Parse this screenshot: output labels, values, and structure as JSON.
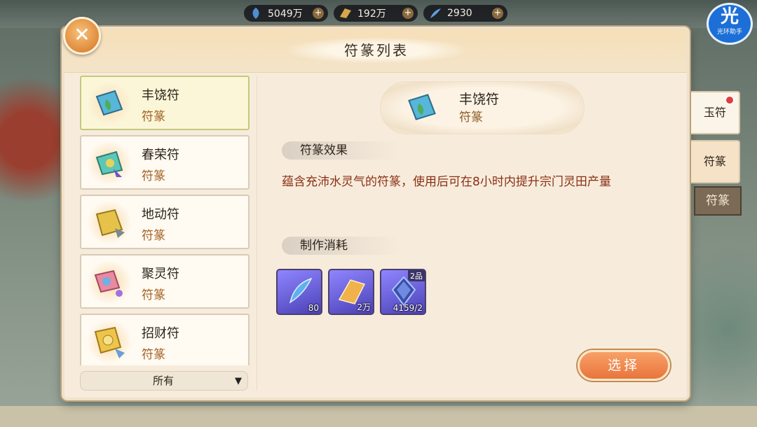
{
  "resources": [
    {
      "icon": "blue-leaf-icon",
      "value": "5049万"
    },
    {
      "icon": "talisman-paper-icon",
      "value": "192万"
    },
    {
      "icon": "blue-feather-icon",
      "value": "2930"
    }
  ],
  "badge": {
    "main": "光",
    "sub": "光环助手"
  },
  "title": "符篆列表",
  "list": {
    "items": [
      {
        "name": "丰饶符",
        "type": "符篆",
        "icon": "fengrao-talisman-icon"
      },
      {
        "name": "春荣符",
        "type": "符篆",
        "icon": "chunrong-talisman-icon"
      },
      {
        "name": "地动符",
        "type": "符篆",
        "icon": "didong-talisman-icon"
      },
      {
        "name": "聚灵符",
        "type": "符篆",
        "icon": "juling-talisman-icon"
      },
      {
        "name": "招财符",
        "type": "符篆",
        "icon": "zhaocai-talisman-icon"
      }
    ],
    "filter": "所有"
  },
  "detail": {
    "name": "丰饶符",
    "type": "符篆",
    "effect_title": "符篆效果",
    "effect_desc": "蕴含充沛水灵气的符篆，使用后可在8小时内提升宗门灵田产量",
    "cost_title": "制作消耗",
    "materials": [
      {
        "icon": "blue-feather-material-icon",
        "count": "80",
        "grade": ""
      },
      {
        "icon": "paper-material-icon",
        "count": "2万",
        "grade": ""
      },
      {
        "icon": "crystal-material-icon",
        "count": "4159/2",
        "grade": "2品"
      }
    ],
    "select_label": "选择"
  },
  "tabs": [
    {
      "label": "玉符",
      "has_dot": true
    },
    {
      "label": "符篆",
      "has_dot": false
    }
  ],
  "scroll_label": "符篆",
  "colors": {
    "accent": "#e8753d",
    "type_text": "#a15f1f",
    "desc_text": "#8a2f14"
  }
}
